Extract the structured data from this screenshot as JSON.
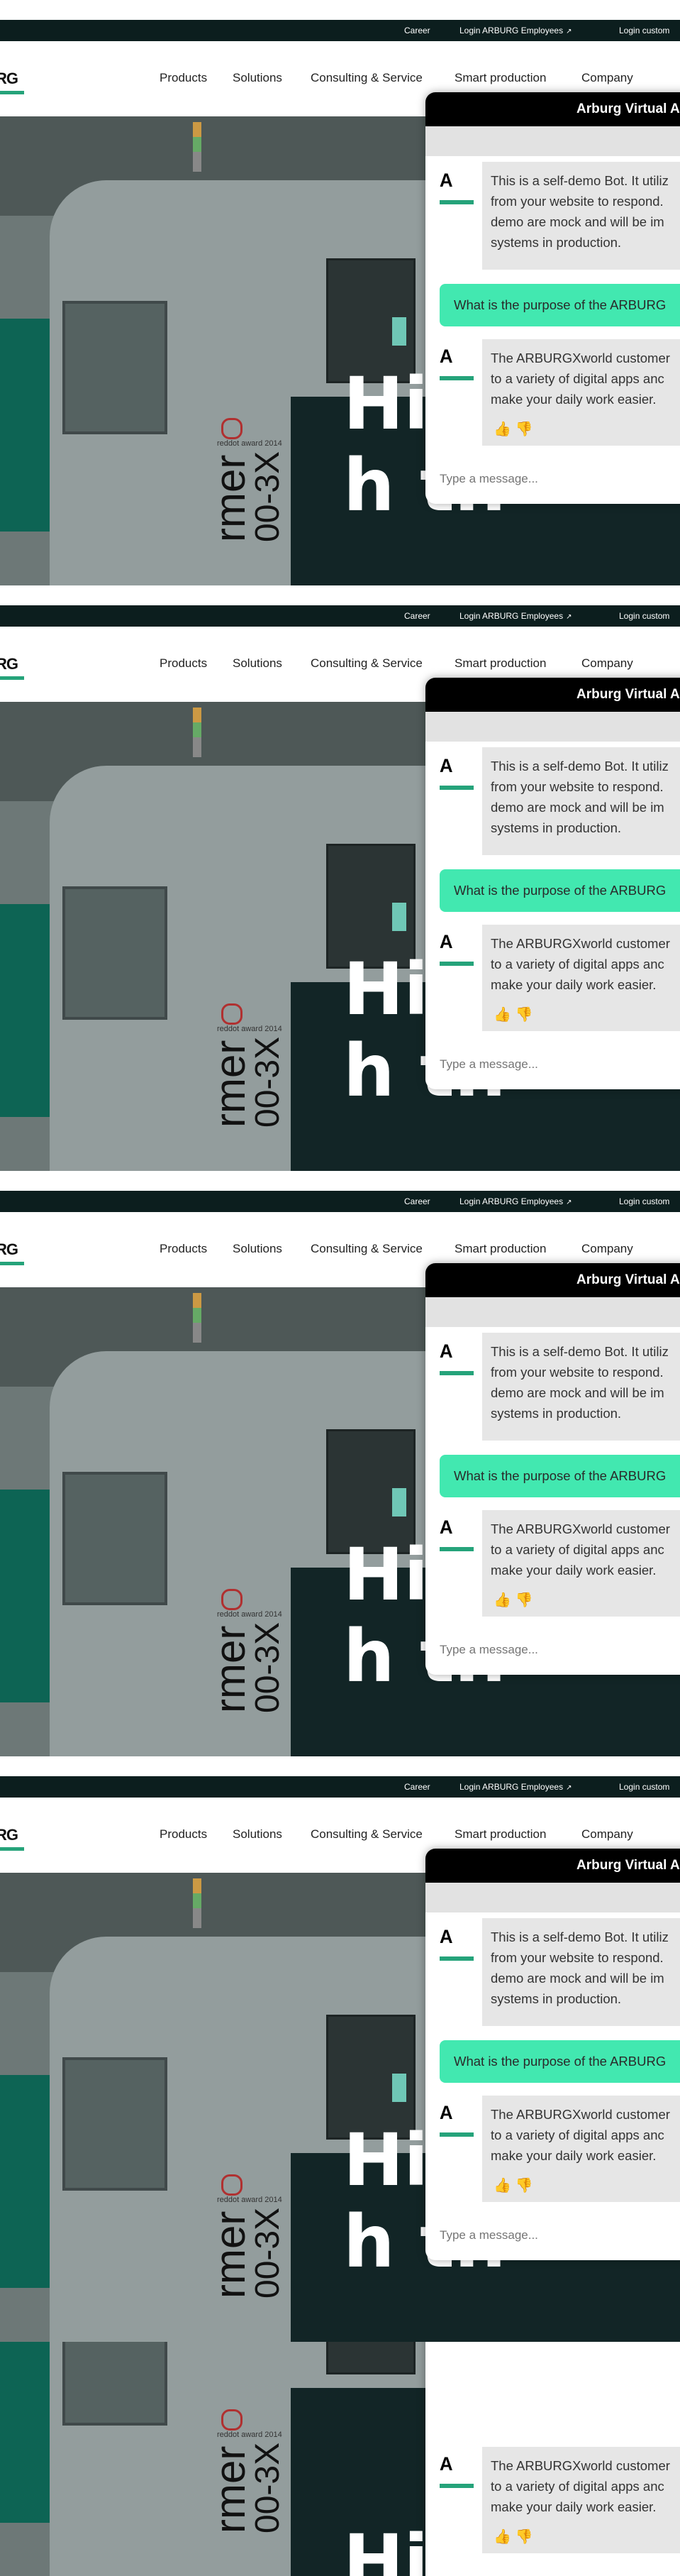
{
  "topbar": {
    "links": [
      "Career",
      "Login ARBURG Employees",
      "Login custom"
    ]
  },
  "navbar": {
    "logo": "RG",
    "items": [
      "Products",
      "Solutions",
      "Consulting & Service",
      "Smart production",
      "Company"
    ]
  },
  "hero": {
    "title_line1": "High qual",
    "title_line2": "h th",
    "machine_label": "rmer",
    "machine_model": "00-3X",
    "award_text": "reddot award 2014"
  },
  "chat": {
    "title": "Arburg Virtual A",
    "bot_intro": [
      "This is a self-demo Bot. It utiliz",
      "from your website to respond.",
      "demo are mock and will be im",
      "systems in production."
    ],
    "user_question": "What is the purpose of the ARBURG",
    "bot_answer": [
      "The ARBURGXworld customer",
      "to a variety of digital apps anc",
      "make your daily work easier."
    ],
    "thumbs": "👍 👎",
    "input_placeholder": "Type a message..."
  },
  "colors": {
    "accent_green": "#25a37a",
    "user_bubble": "#42e8b0",
    "topbar_bg": "#0c1e1e"
  }
}
